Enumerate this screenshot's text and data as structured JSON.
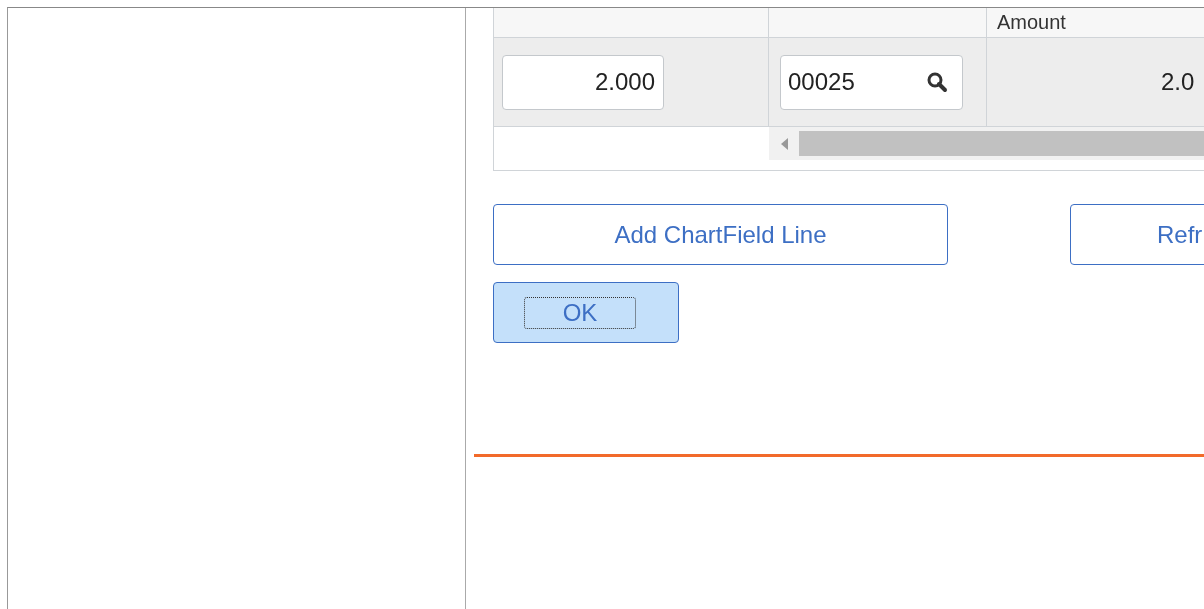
{
  "table": {
    "amount_header": "Amount",
    "row": {
      "quantity": "2.000",
      "code": "00025",
      "amount": "2.0"
    }
  },
  "buttons": [
    {
      "label": "Add ChartField Line",
      "kind": "secondary"
    },
    {
      "label": "Refr",
      "kind": "secondary"
    },
    {
      "label": "OK",
      "kind": "primary"
    }
  ]
}
